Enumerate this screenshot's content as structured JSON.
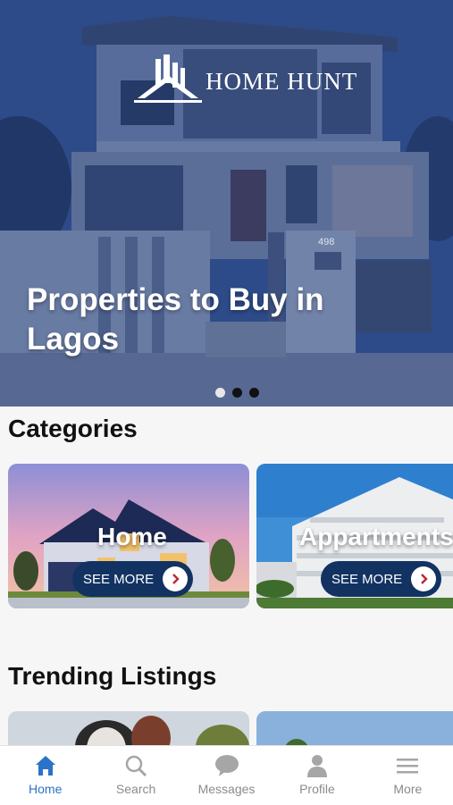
{
  "hero": {
    "brand": "HOME HUNT",
    "title": "Properties to Buy in Lagos",
    "house_number": "498",
    "carousel_dots": 3,
    "active_dot": 0
  },
  "categories": {
    "title": "Categories",
    "items": [
      {
        "label": "Home",
        "button": "SEE MORE"
      },
      {
        "label": "Appartments",
        "button": "SEE MORE"
      }
    ]
  },
  "trending": {
    "title": "Trending Listings"
  },
  "tabbar": {
    "items": [
      {
        "label": "Home",
        "icon": "home-icon",
        "active": true
      },
      {
        "label": "Search",
        "icon": "search-icon",
        "active": false
      },
      {
        "label": "Messages",
        "icon": "chat-icon",
        "active": false
      },
      {
        "label": "Profile",
        "icon": "user-icon",
        "active": false
      },
      {
        "label": "More",
        "icon": "menu-icon",
        "active": false
      }
    ]
  },
  "colors": {
    "accent": "#2b73c6",
    "button_bg": "#123262",
    "hero_tint": "#2f4f8c"
  }
}
